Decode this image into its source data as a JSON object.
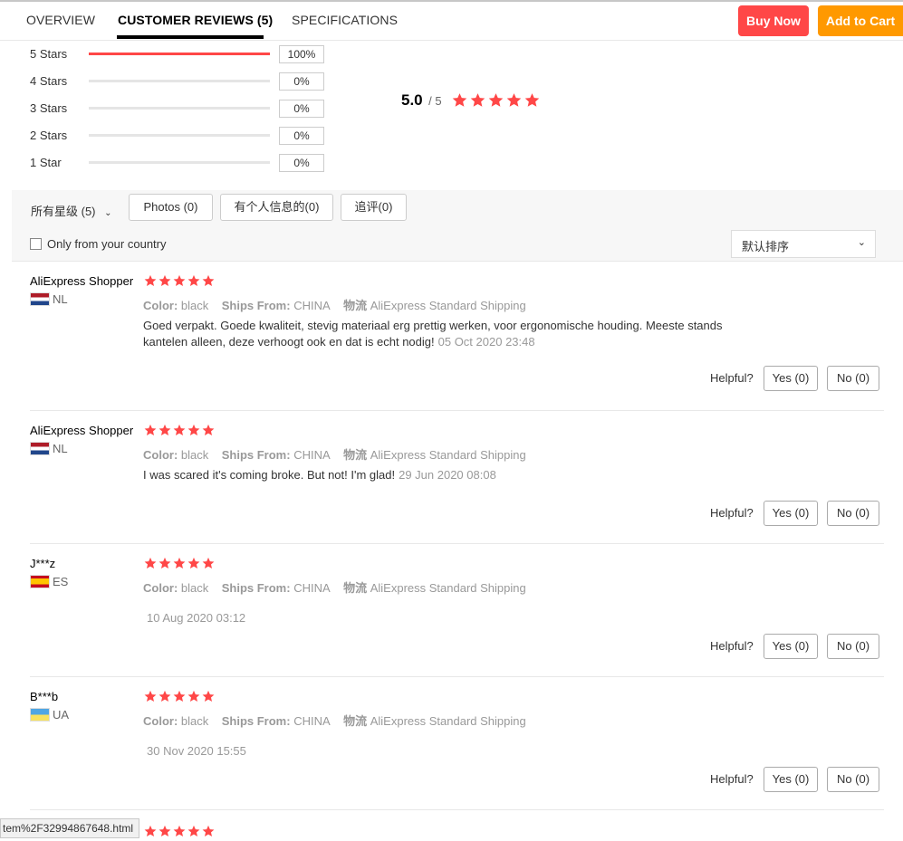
{
  "tabs": [
    {
      "label": "OVERVIEW"
    },
    {
      "label": "CUSTOMER REVIEWS (5)"
    },
    {
      "label": "SPECIFICATIONS"
    }
  ],
  "actions": {
    "buy_now": "Buy Now",
    "add_to_cart": "Add to Cart"
  },
  "colors": {
    "accent_red": "#ff4747",
    "accent_orange": "#ff9900",
    "star": "#ff4747"
  },
  "rating_distribution": [
    {
      "label": "5 Stars",
      "percent": 100,
      "percent_label": "100%"
    },
    {
      "label": "4 Stars",
      "percent": 0,
      "percent_label": "0%"
    },
    {
      "label": "3 Stars",
      "percent": 0,
      "percent_label": "0%"
    },
    {
      "label": "2 Stars",
      "percent": 0,
      "percent_label": "0%"
    },
    {
      "label": "1 Star",
      "percent": 0,
      "percent_label": "0%"
    }
  ],
  "average": {
    "score": "5.0",
    "out_of": "/ 5",
    "stars": 5
  },
  "filters": {
    "level_label": "所有星级 (5)",
    "photos": "Photos (0)",
    "personal_info": "有个人信息的(0)",
    "followup": "追评(0)",
    "only_country": "Only from your country",
    "sort_selected": "默认排序"
  },
  "meta_labels": {
    "color": "Color:",
    "ships_from": "Ships From:",
    "logistics": "物流"
  },
  "reviews": [
    {
      "name": "AliExpress Shopper",
      "country": "NL",
      "flag": "nl",
      "stars": 5,
      "color": "black",
      "ships_from": "CHINA",
      "logistics": "AliExpress Standard Shipping",
      "text": "Goed verpakt. Goede kwaliteit, stevig materiaal erg prettig werken, voor ergonomische houding. Meeste stands kantelen alleen, deze verhoogt ook en dat is echt nodig!",
      "date": "05 Oct 2020 23:48",
      "helpful": "Helpful?",
      "yes": "Yes (0)",
      "no": "No (0)"
    },
    {
      "name": "AliExpress Shopper",
      "country": "NL",
      "flag": "nl",
      "stars": 5,
      "color": "black",
      "ships_from": "CHINA",
      "logistics": "AliExpress Standard Shipping",
      "text": "I was scared it's coming broke. But not! I'm glad!",
      "date": "29 Jun 2020 08:08",
      "helpful": "Helpful?",
      "yes": "Yes (0)",
      "no": "No (0)"
    },
    {
      "name": "J***z",
      "country": "ES",
      "flag": "es",
      "stars": 5,
      "color": "black",
      "ships_from": "CHINA",
      "logistics": "AliExpress Standard Shipping",
      "text": "",
      "date": "10 Aug 2020 03:12",
      "helpful": "Helpful?",
      "yes": "Yes (0)",
      "no": "No (0)"
    },
    {
      "name": "B***b",
      "country": "UA",
      "flag": "ua",
      "stars": 5,
      "color": "black",
      "ships_from": "CHINA",
      "logistics": "AliExpress Standard Shipping",
      "text": "",
      "date": "30 Nov 2020 15:55",
      "helpful": "Helpful?",
      "yes": "Yes (0)",
      "no": "No (0)"
    }
  ],
  "status_bar": {
    "url": "tem%2F32994867648.html"
  }
}
